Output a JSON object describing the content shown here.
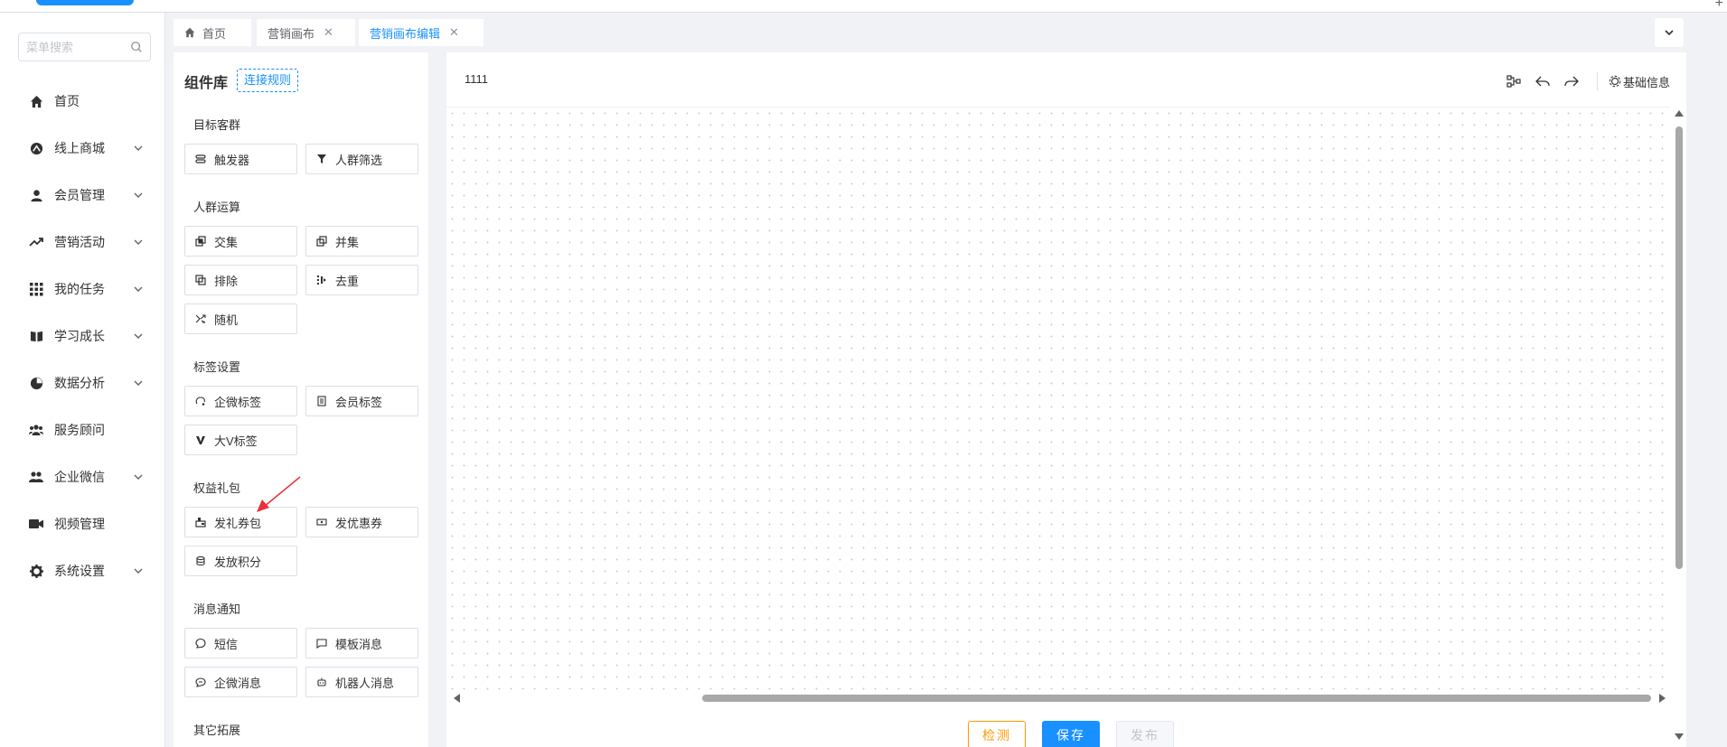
{
  "sidebar": {
    "search_placeholder": "菜单搜索",
    "items": [
      {
        "label": "首页",
        "icon": "home-icon",
        "expandable": false
      },
      {
        "label": "线上商城",
        "icon": "store-icon",
        "expandable": true
      },
      {
        "label": "会员管理",
        "icon": "user-icon",
        "expandable": true
      },
      {
        "label": "营销活动",
        "icon": "trend-icon",
        "expandable": true
      },
      {
        "label": "我的任务",
        "icon": "grid-icon",
        "expandable": true
      },
      {
        "label": "学习成长",
        "icon": "book-icon",
        "expandable": true
      },
      {
        "label": "数据分析",
        "icon": "pie-icon",
        "expandable": true
      },
      {
        "label": "服务顾问",
        "icon": "group-icon",
        "expandable": false
      },
      {
        "label": "企业微信",
        "icon": "team-icon",
        "expandable": true
      },
      {
        "label": "视频管理",
        "icon": "video-icon",
        "expandable": false
      },
      {
        "label": "系统设置",
        "icon": "gear-icon",
        "expandable": true
      }
    ]
  },
  "tabs": [
    {
      "label": "首页",
      "closable": false,
      "active": false
    },
    {
      "label": "营销画布",
      "closable": true,
      "active": false
    },
    {
      "label": "营销画布编辑",
      "closable": true,
      "active": true
    }
  ],
  "tab_close_glyph": "✕",
  "library": {
    "title": "组件库",
    "rule_button": "连接规则",
    "groups": [
      {
        "title": "目标客群",
        "items": [
          {
            "label": "触发器",
            "icon": "trigger-icon"
          },
          {
            "label": "人群筛选",
            "icon": "filter-icon"
          }
        ]
      },
      {
        "title": "人群运算",
        "items": [
          {
            "label": "交集",
            "icon": "intersect-icon"
          },
          {
            "label": "并集",
            "icon": "union-icon"
          },
          {
            "label": "排除",
            "icon": "exclude-icon"
          },
          {
            "label": "去重",
            "icon": "dedupe-icon"
          },
          {
            "label": "随机",
            "icon": "shuffle-icon"
          }
        ]
      },
      {
        "title": "标签设置",
        "items": [
          {
            "label": "企微标签",
            "icon": "wecom-tag-icon"
          },
          {
            "label": "会员标签",
            "icon": "member-tag-icon"
          },
          {
            "label": "大V标签",
            "icon": "v-tag-icon"
          }
        ]
      },
      {
        "title": "权益礼包",
        "items": [
          {
            "label": "发礼券包",
            "icon": "gift-icon"
          },
          {
            "label": "发优惠券",
            "icon": "coupon-icon"
          },
          {
            "label": "发放积分",
            "icon": "points-icon"
          }
        ]
      },
      {
        "title": "消息通知",
        "items": [
          {
            "label": "短信",
            "icon": "sms-icon"
          },
          {
            "label": "模板消息",
            "icon": "template-msg-icon"
          },
          {
            "label": "企微消息",
            "icon": "wecom-msg-icon"
          },
          {
            "label": "机器人消息",
            "icon": "robot-icon"
          }
        ]
      },
      {
        "title": "其它拓展",
        "items": []
      }
    ]
  },
  "canvas": {
    "title": "1111",
    "basic_info": "基础信息",
    "tools": [
      "layout-icon",
      "undo-icon",
      "redo-icon"
    ]
  },
  "actions": {
    "check": "检测",
    "save": "保存",
    "publish": "发布"
  },
  "colors": {
    "primary": "#1890ff",
    "check_orange": "#ff9900",
    "annotation_red": "#e8323c"
  }
}
